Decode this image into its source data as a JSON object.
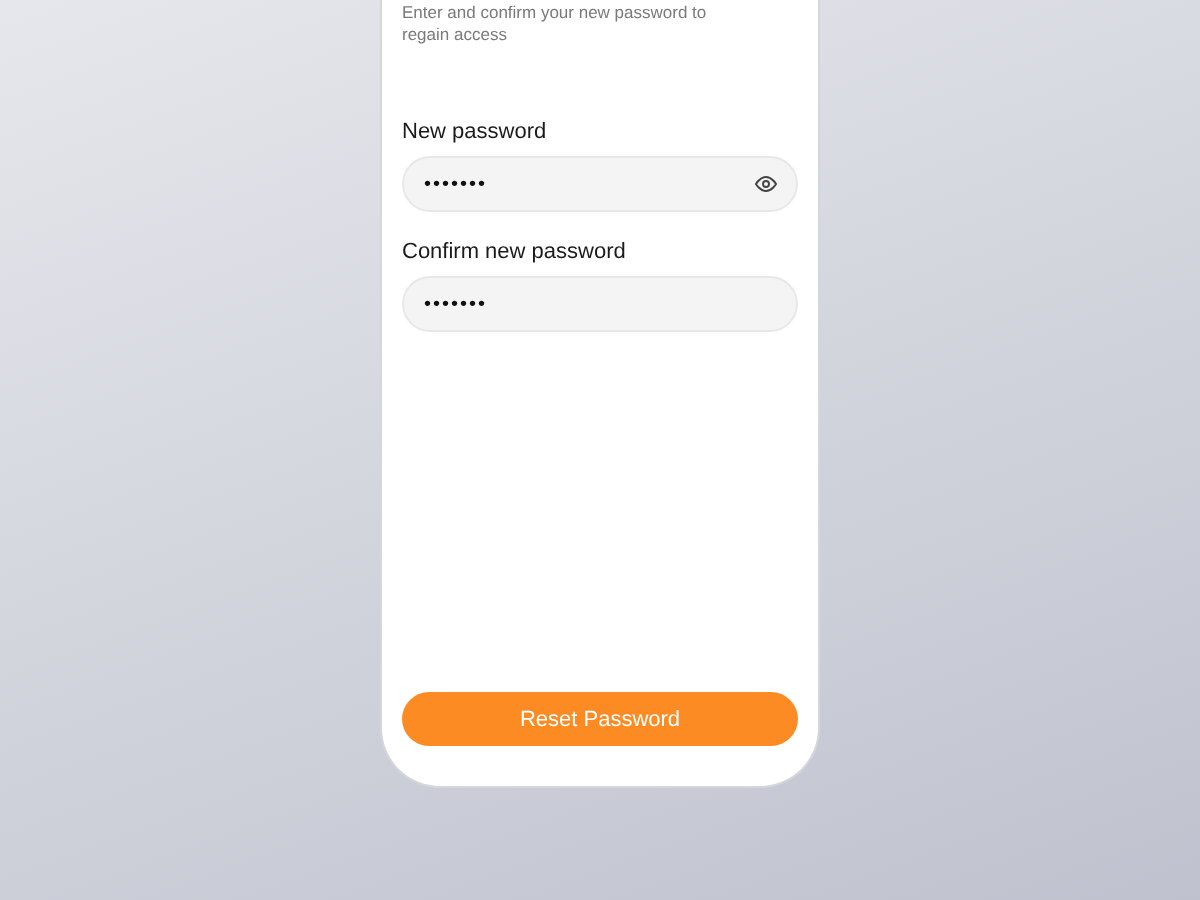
{
  "subtitle": "Enter and confirm your new password to regain access",
  "fields": [
    {
      "label": "New password",
      "value": "•••••••",
      "reveal_toggle": true
    },
    {
      "label": "Confirm new password",
      "value": "•••••••",
      "reveal_toggle": false
    }
  ],
  "button": "Reset Password"
}
